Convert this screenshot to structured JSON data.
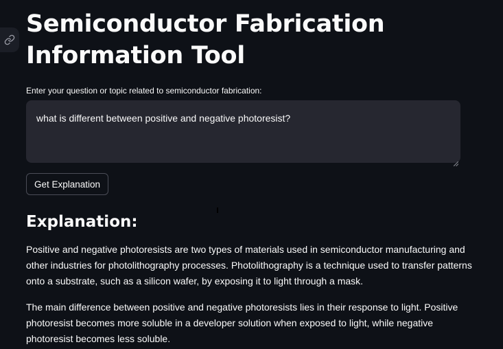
{
  "page": {
    "title_line1": "Semiconductor Fabrication",
    "title_line2": "Information Tool"
  },
  "form": {
    "label": "Enter your question or topic related to semiconductor fabrication:",
    "question_value": "what is different between positive and negative photoresist?",
    "submit_label": "Get Explanation"
  },
  "explanation": {
    "heading": "Explanation:",
    "paragraphs": [
      "Positive and negative photoresists are two types of materials used in semiconductor manufacturing and other industries for photolithography processes. Photolithography is a technique used to transfer patterns onto a substrate, such as a silicon wafer, by exposing it to light through a mask.",
      "The main difference between positive and negative photoresists lies in their response to light. Positive photoresist becomes more soluble in a developer solution when exposed to light, while negative photoresist becomes less soluble."
    ]
  },
  "icons": {
    "anchor": "link-icon"
  },
  "colors": {
    "background": "#0e1117",
    "input_background": "#262730",
    "text": "#fafafa",
    "button_border": "#4b4d57"
  }
}
